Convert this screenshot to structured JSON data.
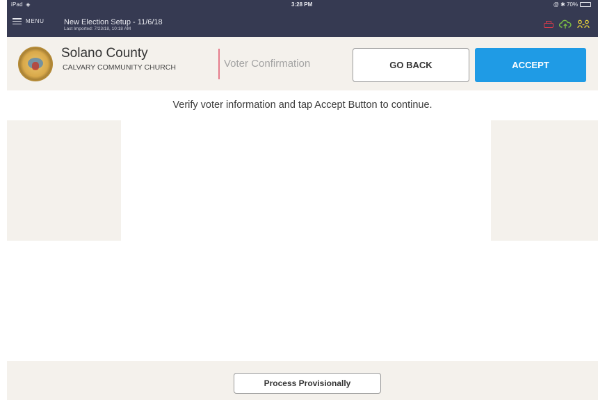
{
  "status_bar": {
    "device": "iPad",
    "time": "3:28 PM",
    "battery": "@ ✱ 70%",
    "battery_level": 0.7
  },
  "topbar": {
    "menu_label": "MENU",
    "setup_title": "New Election Setup - 11/6/18",
    "setup_subtitle": "Last Imported: 7/23/18, 10:18 AM",
    "icons": {
      "printer": {
        "name": "printer-icon",
        "color": "#d83a4a"
      },
      "cloud": {
        "name": "cloud-upload-icon",
        "color": "#7bc043"
      },
      "sync": {
        "name": "device-sync-icon",
        "color": "#e8d33a"
      }
    }
  },
  "header": {
    "county": "Solano County",
    "site": "CALVARY COMMUNITY CHURCH",
    "screen_title": "Voter Confirmation",
    "go_back_label": "GO BACK",
    "accept_label": "ACCEPT",
    "accent_color": "#1f9be5"
  },
  "instruction": "Verify voter information and tap Accept Button to continue.",
  "footer": {
    "provisional_label": "Process Provisionally"
  }
}
